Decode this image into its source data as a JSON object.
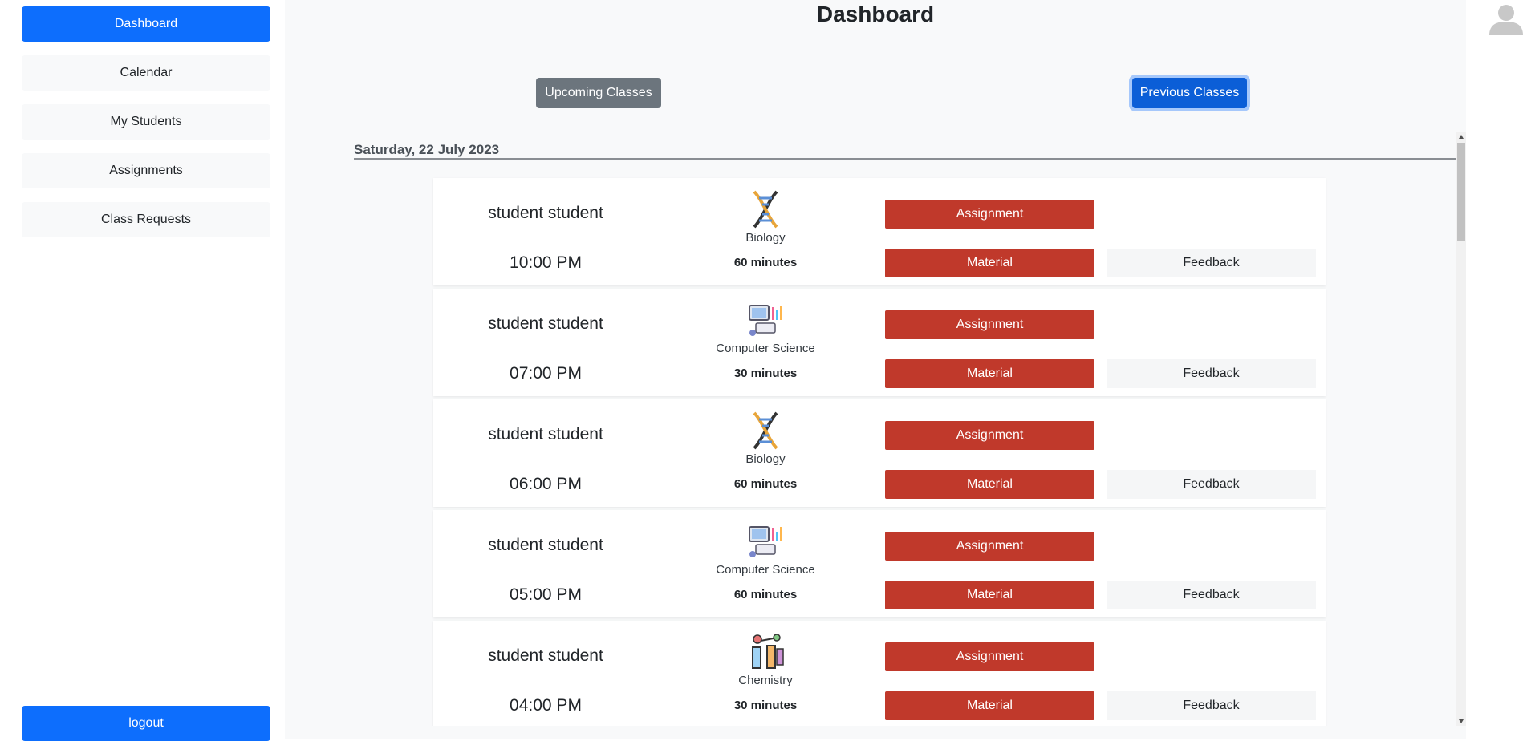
{
  "sidebar": {
    "items": [
      {
        "label": "Dashboard"
      },
      {
        "label": "Calendar"
      },
      {
        "label": "My Students"
      },
      {
        "label": "Assignments"
      },
      {
        "label": "Class Requests"
      }
    ],
    "logout_label": "logout"
  },
  "header": {
    "title": "Dashboard"
  },
  "tabs": {
    "upcoming": "Upcoming Classes",
    "previous": "Previous Classes"
  },
  "date_heading": "Saturday, 22 July 2023",
  "classes": [
    {
      "student": "student student",
      "time": "10:00 PM",
      "subject": "Biology",
      "icon": "dna-icon",
      "duration": "60 minutes",
      "assignment_label": "Assignment",
      "material_label": "Material",
      "feedback_label": "Feedback"
    },
    {
      "student": "student student",
      "time": "07:00 PM",
      "subject": "Computer Science",
      "icon": "computer-science-icon",
      "duration": "30 minutes",
      "assignment_label": "Assignment",
      "material_label": "Material",
      "feedback_label": "Feedback"
    },
    {
      "student": "student student",
      "time": "06:00 PM",
      "subject": "Biology",
      "icon": "dna-icon",
      "duration": "60 minutes",
      "assignment_label": "Assignment",
      "material_label": "Material",
      "feedback_label": "Feedback"
    },
    {
      "student": "student student",
      "time": "05:00 PM",
      "subject": "Computer Science",
      "icon": "computer-science-icon",
      "duration": "60 minutes",
      "assignment_label": "Assignment",
      "material_label": "Material",
      "feedback_label": "Feedback"
    },
    {
      "student": "student student",
      "time": "04:00 PM",
      "subject": "Chemistry",
      "icon": "chemistry-icon",
      "duration": "30 minutes",
      "assignment_label": "Assignment",
      "material_label": "Material",
      "feedback_label": "Feedback"
    }
  ],
  "colors": {
    "primary": "#0d6efd",
    "secondary": "#6c757d",
    "danger": "#c0392b",
    "light": "#f8f9fa"
  }
}
